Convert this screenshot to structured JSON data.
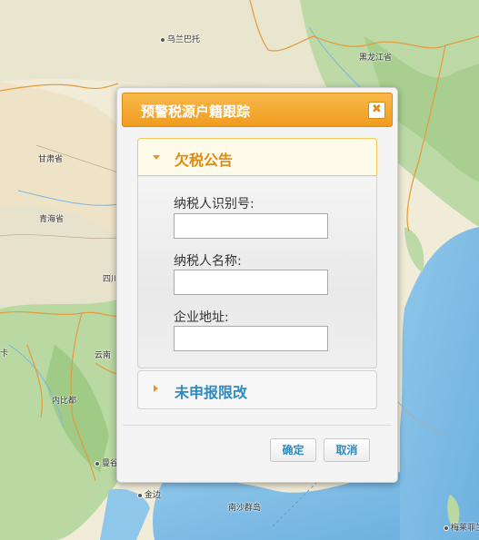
{
  "map": {
    "labels": {
      "wulanbatuo": "乌兰巴托",
      "heilongjiang": "黑龙江省",
      "gansu": "甘肃省",
      "qinghai": "青海省",
      "sichuan": "四川",
      "yunnan": "云南",
      "neipidu": "内比都",
      "mangu": "曼谷",
      "jinbian": "金边",
      "nanshaqundao": "南沙群岛",
      "meilifenglan": "梅莱菲兰",
      "ka": "卡"
    }
  },
  "dialog": {
    "title": "预警税源户籍跟踪",
    "close_symbol": "✖",
    "panels": [
      {
        "label": "欠税公告",
        "expanded": true,
        "fields": [
          {
            "label": "纳税人识别号:",
            "value": "",
            "placeholder": ""
          },
          {
            "label": "纳税人名称:",
            "value": "",
            "placeholder": ""
          },
          {
            "label": "企业地址:",
            "value": "",
            "placeholder": ""
          }
        ]
      },
      {
        "label": "未申报限改",
        "expanded": false
      }
    ],
    "buttons": {
      "ok": "确定",
      "cancel": "取消"
    }
  },
  "colors": {
    "header": "#f0a32a",
    "accent_orange": "#e08a12",
    "accent_blue": "#2e8bc0"
  }
}
